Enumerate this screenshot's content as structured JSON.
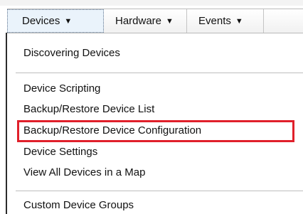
{
  "menubar": {
    "items": [
      {
        "label": "Devices",
        "caret": "▼"
      },
      {
        "label": "Hardware",
        "caret": "▼"
      },
      {
        "label": "Events",
        "caret": "▼"
      }
    ]
  },
  "dropdown": {
    "items": [
      "Discovering Devices",
      "Device Scripting",
      "Backup/Restore Device List",
      "Backup/Restore Device Configuration",
      "Device Settings",
      "View All Devices in a Map",
      "Custom Device Groups"
    ],
    "highlighted_item": "Backup/Restore Device Configuration",
    "highlight_color": "#e0202b"
  },
  "colors": {
    "active_menu_bg": "#eaf3fb",
    "separator": "#bdbdbd"
  }
}
